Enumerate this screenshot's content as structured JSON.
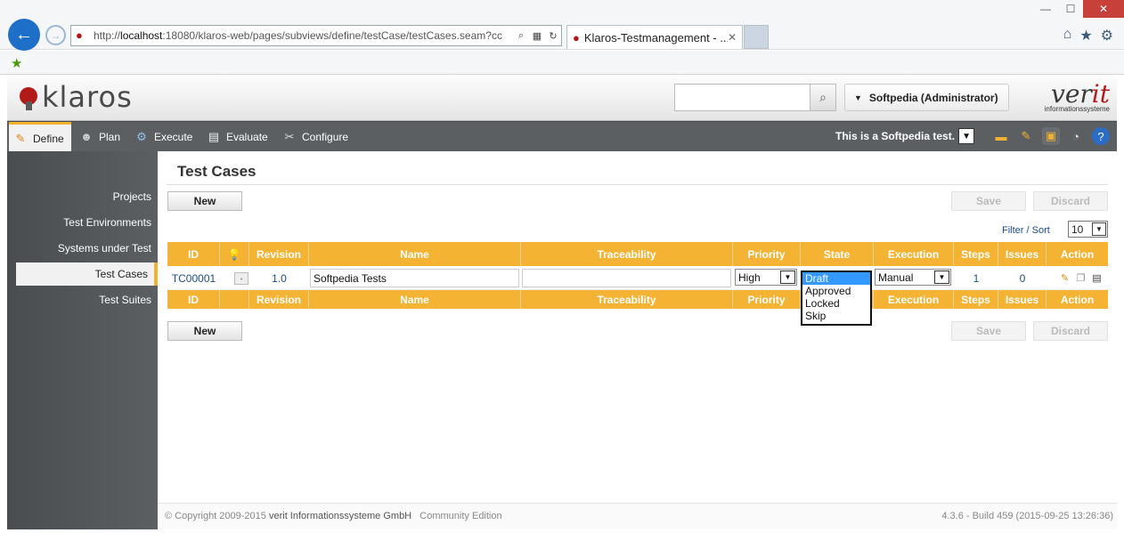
{
  "browser": {
    "url_prefix": "http://",
    "url_host": "localhost",
    "url_rest": ":18080/klaros-web/pages/subviews/define/testCase/testCases.seam?cc",
    "tab_title": "Klaros-Testmanagement - ...",
    "window_controls": [
      "—",
      "☐",
      "✕"
    ],
    "icons": [
      "home-icon",
      "star-icon",
      "gear-icon"
    ]
  },
  "header": {
    "logo_text": "klaros",
    "search_placeholder": "",
    "user_label": "Softpedia (Administrator)",
    "verit_word": "ver",
    "verit_accent": "it",
    "verit_sub": "informationssysteme"
  },
  "nav": {
    "items": [
      {
        "label": "Define",
        "icon": "pencil-icon"
      },
      {
        "label": "Plan",
        "icon": "users-icon"
      },
      {
        "label": "Execute",
        "icon": "gear-icon"
      },
      {
        "label": "Evaluate",
        "icon": "chart-icon"
      },
      {
        "label": "Configure",
        "icon": "wrench-icon"
      }
    ],
    "project_label": "This is a Softpedia test."
  },
  "sidebar": {
    "items": [
      {
        "label": "Projects"
      },
      {
        "label": "Test Environments"
      },
      {
        "label": "Systems under Test"
      },
      {
        "label": "Test Cases"
      },
      {
        "label": "Test Suites"
      }
    ]
  },
  "main": {
    "title": "Test Cases",
    "new_label": "New",
    "save_label": "Save",
    "discard_label": "Discard",
    "filter_label": "Filter / Sort",
    "page_size": "10",
    "columns": [
      "ID",
      "",
      "Revision",
      "Name",
      "Traceability",
      "Priority",
      "State",
      "Execution",
      "Steps",
      "Issues",
      "Action"
    ],
    "rows": [
      {
        "id": "TC00001",
        "revision": "1.0",
        "name": "Softpedia Tests",
        "traceability": "",
        "priority": "High",
        "state": "Draft",
        "execution": "Manual",
        "steps": "1",
        "issues": "0"
      }
    ],
    "state_options": [
      "Draft",
      "Approved",
      "Locked",
      "Skip"
    ]
  },
  "footer": {
    "copyright": "© Copyright 2009-2015",
    "company": "verit Informationssysteme GmbH",
    "edition": "Community Edition",
    "version": "4.3.6 - Build 459 (2015-09-25 13:26:36)"
  },
  "colors": {
    "accent": "#f5b334",
    "nav_bg": "#5c5f62",
    "brand_red": "#b21a1a",
    "link_blue": "#1a4b8a"
  }
}
